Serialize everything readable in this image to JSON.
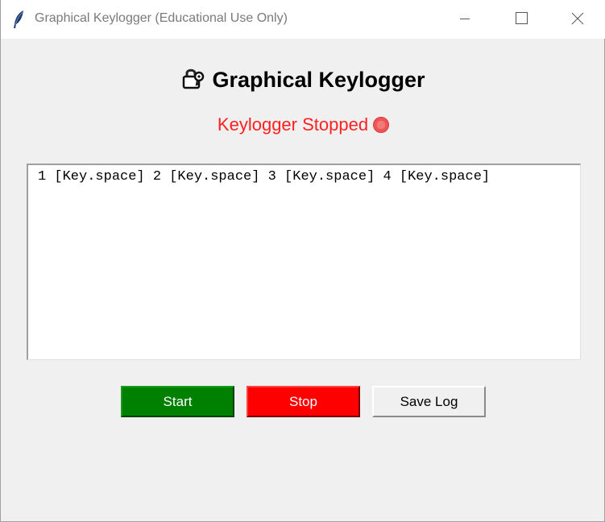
{
  "window": {
    "title": "Graphical Keylogger (Educational Use Only)"
  },
  "header": {
    "title": "Graphical Keylogger",
    "icon": "lock-with-key-icon"
  },
  "status": {
    "text": "Keylogger Stopped",
    "indicator": "red-circle-icon",
    "color": "#ff2020"
  },
  "log": {
    "content": "1 [Key.space] 2 [Key.space] 3 [Key.space] 4 [Key.space]"
  },
  "buttons": {
    "start_label": "Start",
    "stop_label": "Stop",
    "save_label": "Save Log",
    "start_color": "#008000",
    "stop_color": "#ff0000"
  }
}
